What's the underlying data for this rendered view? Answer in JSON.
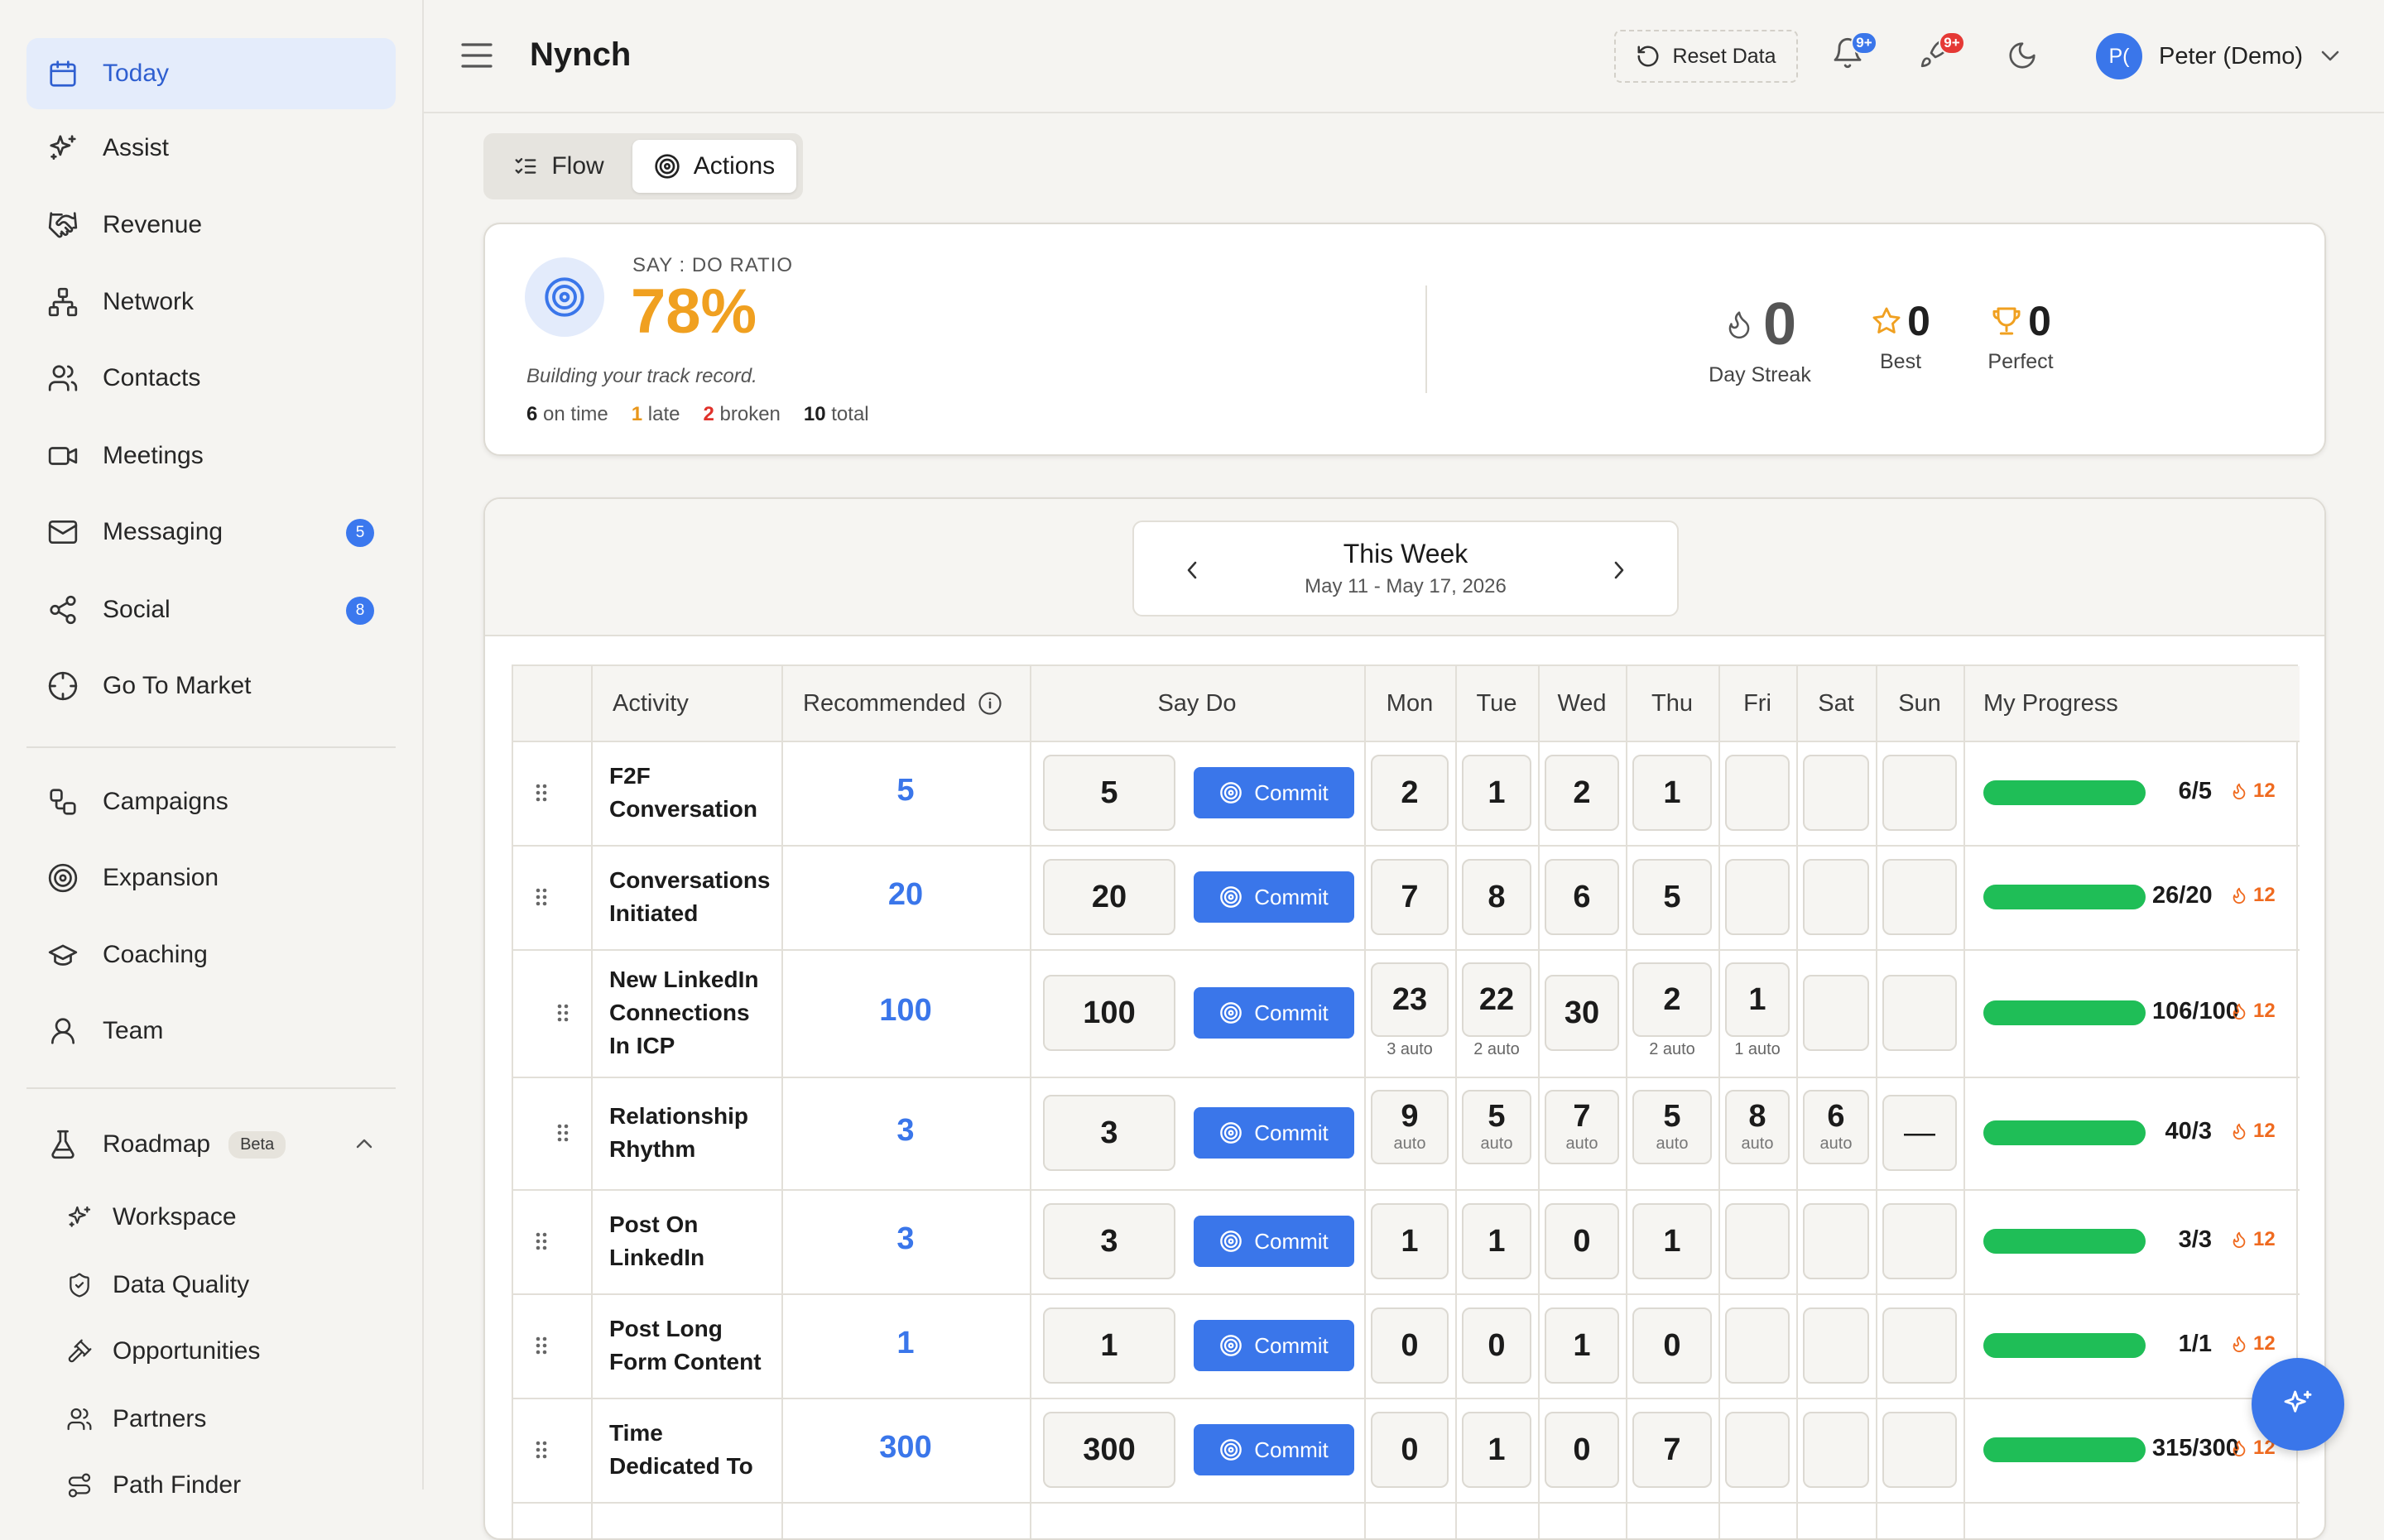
{
  "sidebar": {
    "items": [
      {
        "label": "Today",
        "icon": "calendar-icon",
        "active": true
      },
      {
        "label": "Assist",
        "icon": "sparkles-icon"
      },
      {
        "label": "Revenue",
        "icon": "handshake-icon"
      },
      {
        "label": "Network",
        "icon": "network-icon"
      },
      {
        "label": "Contacts",
        "icon": "users-icon"
      },
      {
        "label": "Meetings",
        "icon": "video-icon"
      },
      {
        "label": "Messaging",
        "icon": "mail-icon",
        "badge": "5"
      },
      {
        "label": "Social",
        "icon": "share-icon",
        "badge": "8"
      },
      {
        "label": "Go To Market",
        "icon": "crosshair-icon"
      }
    ],
    "items2": [
      {
        "label": "Campaigns",
        "icon": "workflow-icon"
      },
      {
        "label": "Expansion",
        "icon": "target-icon"
      },
      {
        "label": "Coaching",
        "icon": "graduation-cap-icon"
      },
      {
        "label": "Team",
        "icon": "user-icon"
      }
    ],
    "roadmap": {
      "label": "Roadmap",
      "badge": "Beta"
    },
    "roadmap_items": [
      {
        "label": "Workspace",
        "icon": "sparkles-icon"
      },
      {
        "label": "Data Quality",
        "icon": "shield-check-icon"
      },
      {
        "label": "Opportunities",
        "icon": "pickaxe-icon"
      },
      {
        "label": "Partners",
        "icon": "users-icon"
      },
      {
        "label": "Path Finder",
        "icon": "route-icon"
      }
    ]
  },
  "header": {
    "title": "Nynch",
    "reset_label": "Reset Data",
    "notif_badge": "9+",
    "rocket_badge": "9+",
    "avatar_initials": "P(",
    "user_name": "Peter (Demo)"
  },
  "tabs": [
    {
      "label": "Flow",
      "active": false
    },
    {
      "label": "Actions",
      "active": true
    }
  ],
  "ratio": {
    "label": "SAY : DO RATIO",
    "value": "78%",
    "subtitle": "Building your track record.",
    "stats": [
      {
        "num": "6",
        "label": "on time",
        "color": "#1f1f1f"
      },
      {
        "num": "1",
        "label": "late",
        "color": "#e8961a"
      },
      {
        "num": "2",
        "label": "broken",
        "color": "#e0322b"
      },
      {
        "num": "10",
        "label": "total",
        "color": "#1f1f1f"
      }
    ],
    "streak": {
      "value": "0",
      "label": "Day Streak"
    },
    "best": {
      "value": "0",
      "label": "Best"
    },
    "perfect": {
      "value": "0",
      "label": "Perfect"
    }
  },
  "week": {
    "title": "This Week",
    "range": "May 11 - May 17, 2026"
  },
  "table": {
    "headers": {
      "activity": "Activity",
      "recommended": "Recommended",
      "saydo": "Say Do",
      "progress": "My Progress"
    },
    "days": [
      "Mon",
      "Tue",
      "Wed",
      "Thu",
      "Fri",
      "Sat",
      "Sun"
    ],
    "commit_label": "Commit",
    "rows": [
      {
        "activity": [
          "F2F",
          "Conversation"
        ],
        "recommended": "5",
        "say": "5",
        "days": [
          {
            "v": "2"
          },
          {
            "v": "1"
          },
          {
            "v": "2"
          },
          {
            "v": "1"
          },
          {
            "v": ""
          },
          {
            "v": ""
          },
          {
            "v": ""
          }
        ],
        "progress": 1.0,
        "progress_text": "6/5",
        "streak": "12"
      },
      {
        "activity": [
          "Conversations",
          "Initiated"
        ],
        "recommended": "20",
        "say": "20",
        "days": [
          {
            "v": "7"
          },
          {
            "v": "8"
          },
          {
            "v": "6"
          },
          {
            "v": "5"
          },
          {
            "v": ""
          },
          {
            "v": ""
          },
          {
            "v": ""
          }
        ],
        "progress": 1.0,
        "progress_text": "26/20",
        "streak": "12"
      },
      {
        "activity": [
          "New LinkedIn",
          "Connections",
          "In ICP"
        ],
        "recommended": "100",
        "say": "100",
        "days": [
          {
            "v": "23",
            "note": "3 auto"
          },
          {
            "v": "22",
            "note": "2 auto"
          },
          {
            "v": "30"
          },
          {
            "v": "2",
            "note": "2 auto"
          },
          {
            "v": "1",
            "note": "1 auto"
          },
          {
            "v": ""
          },
          {
            "v": ""
          }
        ],
        "progress": 1.0,
        "progress_text": "106/100",
        "streak": "12"
      },
      {
        "activity": [
          "Relationship",
          "Rhythm"
        ],
        "recommended": "3",
        "say": "3",
        "days": [
          {
            "v": "9",
            "note": "auto"
          },
          {
            "v": "5",
            "note": "auto"
          },
          {
            "v": "7",
            "note": "auto"
          },
          {
            "v": "5",
            "note": "auto"
          },
          {
            "v": "8",
            "note": "auto"
          },
          {
            "v": "6",
            "note": "auto"
          },
          {
            "v": "—"
          }
        ],
        "progress": 1.0,
        "progress_text": "40/3",
        "streak": "12"
      },
      {
        "activity": [
          "Post On",
          "LinkedIn"
        ],
        "recommended": "3",
        "say": "3",
        "days": [
          {
            "v": "1"
          },
          {
            "v": "1"
          },
          {
            "v": "0"
          },
          {
            "v": "1"
          },
          {
            "v": ""
          },
          {
            "v": ""
          },
          {
            "v": ""
          }
        ],
        "progress": 1.0,
        "progress_text": "3/3",
        "streak": "12"
      },
      {
        "activity": [
          "Post Long",
          "Form Content"
        ],
        "recommended": "1",
        "say": "1",
        "days": [
          {
            "v": "0"
          },
          {
            "v": "0"
          },
          {
            "v": "1"
          },
          {
            "v": "0"
          },
          {
            "v": ""
          },
          {
            "v": ""
          },
          {
            "v": ""
          }
        ],
        "progress": 1.0,
        "progress_text": "1/1",
        "streak": "12"
      },
      {
        "activity": [
          "Time",
          "Dedicated To"
        ],
        "recommended": "300",
        "say": "300",
        "days": [
          {
            "v": "0"
          },
          {
            "v": "1"
          },
          {
            "v": "0"
          },
          {
            "v": "7"
          },
          {
            "v": ""
          },
          {
            "v": ""
          },
          {
            "v": ""
          }
        ],
        "progress": 1.0,
        "progress_text": "315/300",
        "streak": "12"
      }
    ]
  },
  "colors": {
    "accent": "#3a76ea",
    "orange": "#f0a020",
    "green": "#1fbe57",
    "streak": "#ef6a1f"
  }
}
